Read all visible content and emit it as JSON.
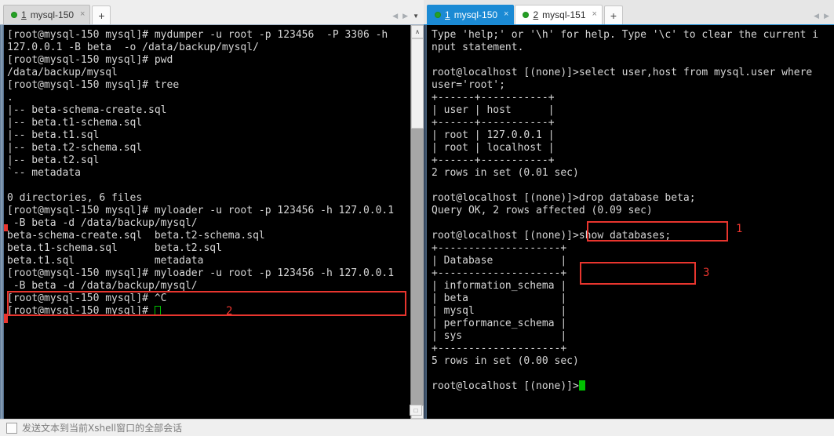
{
  "left_pane": {
    "tabs": [
      {
        "index": "1",
        "title": "mysql-150",
        "state": "inactive",
        "dot_color": "#25a025",
        "close_glyph": "×"
      }
    ],
    "new_tab_glyph": "+",
    "nav": {
      "prev_glyph": "◀",
      "next_glyph": "▶",
      "menu_glyph": "▼"
    },
    "terminal": {
      "lines": [
        "[root@mysql-150 mysql]# mydumper -u root -p 123456  -P 3306 -h",
        "127.0.0.1 -B beta  -o /data/backup/mysql/",
        "[root@mysql-150 mysql]# pwd",
        "/data/backup/mysql",
        "[root@mysql-150 mysql]# tree",
        ".",
        "|-- beta-schema-create.sql",
        "|-- beta.t1-schema.sql",
        "|-- beta.t1.sql",
        "|-- beta.t2-schema.sql",
        "|-- beta.t2.sql",
        "`-- metadata",
        "",
        "0 directories, 6 files",
        "[root@mysql-150 mysql]# myloader -u root -p 123456 -h 127.0.0.1",
        " -B beta -d /data/backup/mysql/",
        "beta-schema-create.sql  beta.t2-schema.sql",
        "beta.t1-schema.sql      beta.t2.sql",
        "beta.t1.sql             metadata",
        "[root@mysql-150 mysql]# myloader -u root -p 123456 -h 127.0.0.1",
        " -B beta -d /data/backup/mysql/",
        "[root@mysql-150 mysql]# ^C",
        "[root@mysql-150 mysql]# "
      ]
    },
    "annotation": {
      "label": "2"
    },
    "scrollbar": {
      "up_glyph": "∧",
      "down_glyph": "∨"
    }
  },
  "right_pane": {
    "tabs": [
      {
        "index": "1",
        "title": "mysql-150",
        "state": "active",
        "dot_color": "#25a025",
        "close_glyph": "×"
      },
      {
        "index": "2",
        "title": "mysql-151",
        "state": "inactive",
        "dot_color": "#25a025",
        "close_glyph": "×"
      }
    ],
    "new_tab_glyph": "+",
    "nav": {
      "prev_glyph": "◀",
      "next_glyph": "▶"
    },
    "terminal": {
      "lines": [
        "Type 'help;' or '\\h' for help. Type '\\c' to clear the current i",
        "nput statement.",
        "",
        "root@localhost [(none)]>select user,host from mysql.user where",
        "user='root';",
        "+------+-----------+",
        "| user | host      |",
        "+------+-----------+",
        "| root | 127.0.0.1 |",
        "| root | localhost |",
        "+------+-----------+",
        "2 rows in set (0.01 sec)",
        "",
        "root@localhost [(none)]>drop database beta;",
        "Query OK, 2 rows affected (0.09 sec)",
        "",
        "root@localhost [(none)]>show databases;",
        "+--------------------+",
        "| Database           |",
        "+--------------------+",
        "| information_schema |",
        "| beta               |",
        "| mysql              |",
        "| performance_schema |",
        "| sys                |",
        "+--------------------+",
        "5 rows in set (0.00 sec)",
        "",
        "root@localhost [(none)]>"
      ]
    },
    "annotations": [
      {
        "label": "1"
      },
      {
        "label": "3"
      }
    ]
  },
  "statusbar": {
    "checkbox_checked": false,
    "text": "发送文本到当前Xshell窗口的全部会话"
  },
  "colors": {
    "accent_blue": "#1b8ad4",
    "annotation_red": "#e8352e",
    "terminal_bg": "#000000",
    "terminal_fg": "#d6d6d6",
    "cursor_green": "#00c000",
    "tab_dot_green": "#25a025"
  }
}
